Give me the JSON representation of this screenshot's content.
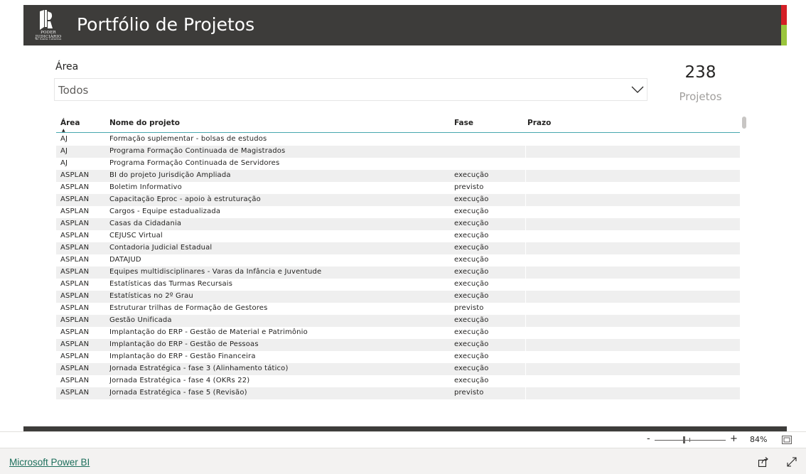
{
  "header": {
    "title": "Portfólio de Projetos",
    "logo_line1": "PODER JUDICIÁRIO",
    "logo_line2": "de Santa Catarina",
    "accent_colors": [
      "#d41f26",
      "#9ac53c"
    ],
    "background_color": "#3d3c3a"
  },
  "slicer": {
    "label": "Área",
    "value": "Todos",
    "icon": "chevron-down-icon"
  },
  "card": {
    "value": "238",
    "label": "Projetos"
  },
  "table": {
    "columns": [
      "Área",
      "Nome do projeto",
      "Fase",
      "Prazo"
    ],
    "sort_indicator": "▲",
    "rows": [
      {
        "area": "AJ",
        "nome": "Formação suplementar - bolsas de estudos",
        "fase": "",
        "prazo": ""
      },
      {
        "area": "AJ",
        "nome": "Programa Formação Continuada de Magistrados",
        "fase": "",
        "prazo": ""
      },
      {
        "area": "AJ",
        "nome": "Programa Formação Continuada de Servidores",
        "fase": "",
        "prazo": ""
      },
      {
        "area": "ASPLAN",
        "nome": "BI do projeto Jurisdição Ampliada",
        "fase": "execução",
        "prazo": ""
      },
      {
        "area": "ASPLAN",
        "nome": "Boletim Informativo",
        "fase": "previsto",
        "prazo": ""
      },
      {
        "area": "ASPLAN",
        "nome": "Capacitação Eproc - apoio à estruturação",
        "fase": "execução",
        "prazo": ""
      },
      {
        "area": "ASPLAN",
        "nome": "Cargos - Equipe estadualizada",
        "fase": "execução",
        "prazo": ""
      },
      {
        "area": "ASPLAN",
        "nome": "Casas da Cidadania",
        "fase": "execução",
        "prazo": ""
      },
      {
        "area": "ASPLAN",
        "nome": "CEJUSC Virtual",
        "fase": "execução",
        "prazo": ""
      },
      {
        "area": "ASPLAN",
        "nome": "Contadoria Judicial Estadual",
        "fase": "execução",
        "prazo": ""
      },
      {
        "area": "ASPLAN",
        "nome": "DATAJUD",
        "fase": "execução",
        "prazo": ""
      },
      {
        "area": "ASPLAN",
        "nome": "Equipes multidisciplinares - Varas da Infância e Juventude",
        "fase": "execução",
        "prazo": ""
      },
      {
        "area": "ASPLAN",
        "nome": "Estatísticas das Turmas Recursais",
        "fase": "execução",
        "prazo": ""
      },
      {
        "area": "ASPLAN",
        "nome": "Estatísticas no 2º Grau",
        "fase": "execução",
        "prazo": ""
      },
      {
        "area": "ASPLAN",
        "nome": "Estruturar trilhas de Formação de Gestores",
        "fase": "previsto",
        "prazo": ""
      },
      {
        "area": "ASPLAN",
        "nome": "Gestão Unificada",
        "fase": "execução",
        "prazo": ""
      },
      {
        "area": "ASPLAN",
        "nome": "Implantação do ERP - Gestão de Material e Patrimônio",
        "fase": "execução",
        "prazo": ""
      },
      {
        "area": "ASPLAN",
        "nome": "Implantação do ERP - Gestão de Pessoas",
        "fase": "execução",
        "prazo": ""
      },
      {
        "area": "ASPLAN",
        "nome": "Implantação do ERP - Gestão Financeira",
        "fase": "execução",
        "prazo": ""
      },
      {
        "area": "ASPLAN",
        "nome": "Jornada Estratégica - fase 3 (Alinhamento tático)",
        "fase": "execução",
        "prazo": ""
      },
      {
        "area": "ASPLAN",
        "nome": "Jornada Estratégica - fase 4 (OKRs 22)",
        "fase": "execução",
        "prazo": ""
      },
      {
        "area": "ASPLAN",
        "nome": "Jornada Estratégica - fase 5 (Revisão)",
        "fase": "previsto",
        "prazo": ""
      }
    ]
  },
  "zoom": {
    "minus": "-",
    "plus": "+",
    "percent": "84%"
  },
  "footer": {
    "link": "Microsoft Power BI",
    "icons": [
      "share-icon",
      "fullscreen-icon",
      "fit-to-page-icon"
    ]
  }
}
